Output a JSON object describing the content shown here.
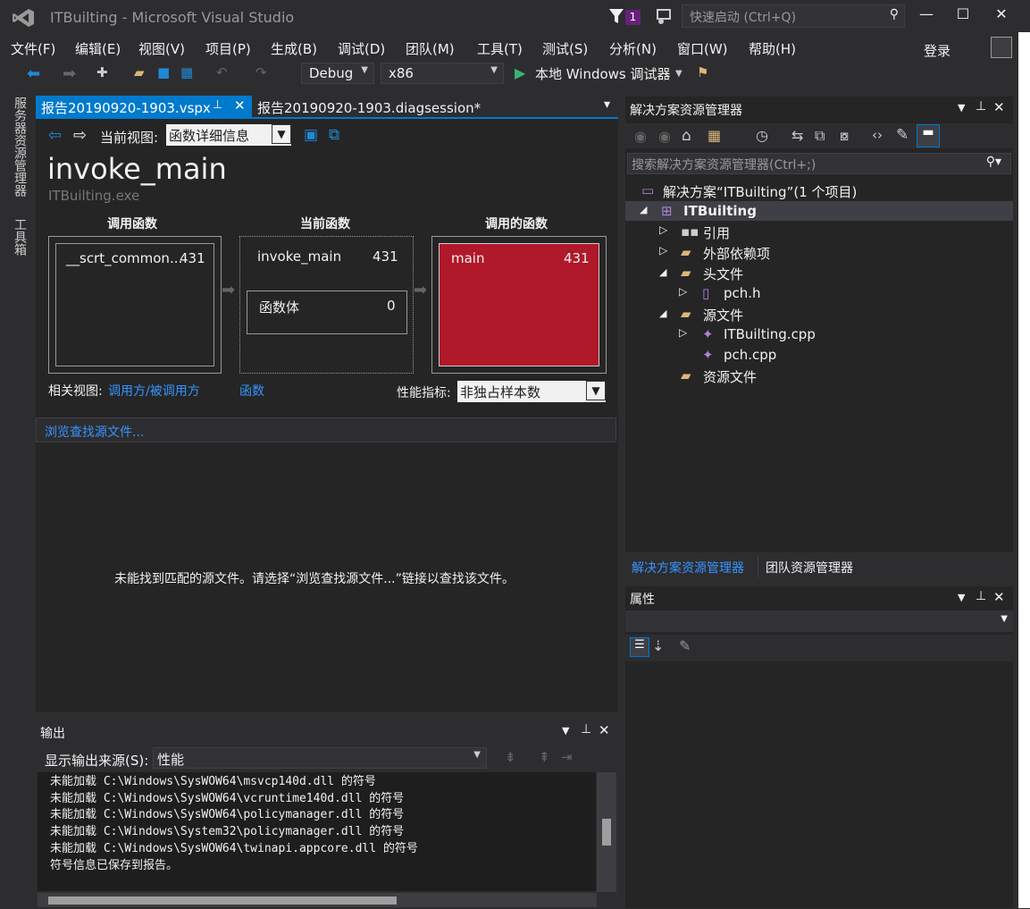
{
  "window": {
    "title": "ITBuilting - Microsoft Visual Studio",
    "notification_count": "1",
    "quick_launch_placeholder": "快速启动 (Ctrl+Q)",
    "login": "登录"
  },
  "menu": [
    "文件(F)",
    "编辑(E)",
    "视图(V)",
    "项目(P)",
    "生成(B)",
    "调试(D)",
    "团队(M)",
    "工具(T)",
    "测试(S)",
    "分析(N)",
    "窗口(W)",
    "帮助(H)"
  ],
  "toolbar": {
    "config": "Debug",
    "platform": "x86",
    "debugger": "本地 Windows 调试器"
  },
  "left_strip": {
    "server_explorer": "服务器资源管理器",
    "toolbox": "工具箱"
  },
  "tabs": {
    "active": "报告20190920-1903.vspx",
    "inactive": "报告20190920-1903.diagsession*"
  },
  "report": {
    "current_view_label": "当前视图:",
    "current_view": "函数详细信息",
    "function_name": "invoke_main",
    "module": "ITBuilting.exe",
    "callers_header": "调用函数",
    "current_header": "当前函数",
    "callees_header": "调用的函数",
    "caller_name": "__scrt_common...",
    "caller_value": "431",
    "current_name": "invoke_main",
    "current_value": "431",
    "body_name": "函数体",
    "body_value": "0",
    "callee_name": "main",
    "callee_value": "431",
    "related_label": "相关视图:",
    "related_link1": "调用方/被调用方",
    "related_link2": "函数",
    "metric_label": "性能指标:",
    "metric_value": "非独占样本数",
    "browse_link": "浏览查找源文件...",
    "no_source_msg": "未能找到匹配的源文件。请选择“浏览查找源文件...”链接以查找该文件。"
  },
  "output": {
    "title": "输出",
    "source_label": "显示输出来源(S):",
    "source_value": "性能",
    "lines": "未能加载 C:\\Windows\\SysWOW64\\msvcp140d.dll 的符号\n未能加载 C:\\Windows\\SysWOW64\\vcruntime140d.dll 的符号\n未能加载 C:\\Windows\\SysWOW64\\policymanager.dll 的符号\n未能加载 C:\\Windows\\System32\\policymanager.dll 的符号\n未能加载 C:\\Windows\\SysWOW64\\twinapi.appcore.dll 的符号\n符号信息已保存到报告。"
  },
  "solution_explorer": {
    "title": "解决方案资源管理器",
    "search_placeholder": "搜索解决方案资源管理器(Ctrl+;)",
    "solution": "解决方案“ITBuilting”(1 个项目)",
    "project": "ITBuilting",
    "items": [
      "引用",
      "外部依赖项",
      "头文件",
      "pch.h",
      "源文件",
      "ITBuilting.cpp",
      "pch.cpp",
      "资源文件"
    ],
    "tab_active": "解决方案资源管理器",
    "tab_inactive": "团队资源管理器"
  },
  "properties": {
    "title": "属性"
  },
  "colors": {
    "accent": "#007acc",
    "callee_fill": "#b0192a",
    "link": "#3794ff"
  }
}
